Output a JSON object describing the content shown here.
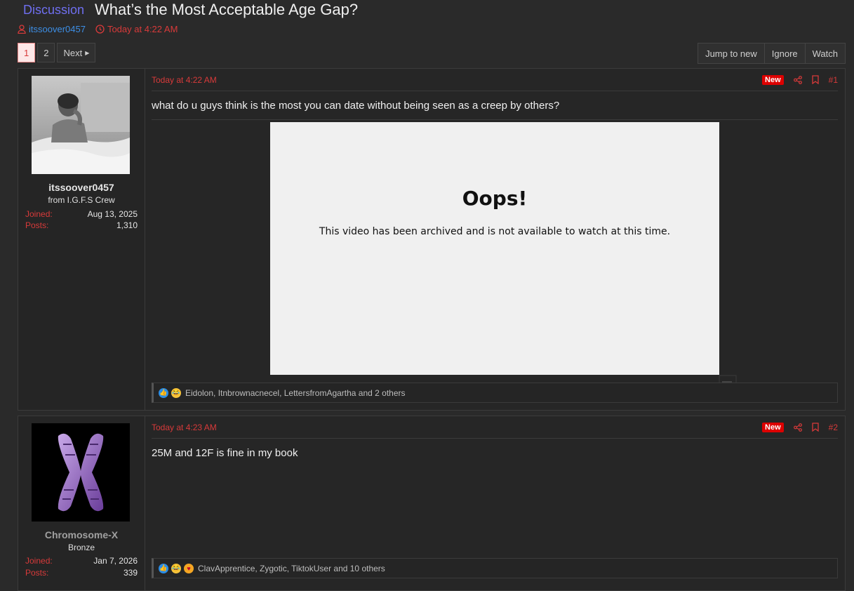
{
  "thread": {
    "prefix": "Discussion",
    "title": "What’s the Most Acceptable Age Gap?",
    "author": "itssoover0457",
    "time": "Today at 4:22 AM"
  },
  "pagination": {
    "pages": [
      "1",
      "2"
    ],
    "current": "1",
    "next_label": "Next"
  },
  "actions": {
    "jump_label": "Jump to new",
    "ignore_label": "Ignore",
    "watch_label": "Watch"
  },
  "posts": [
    {
      "user": {
        "name": "itssoover0457",
        "name_color": "#3d8fe6",
        "title": "from I.G.F.S Crew",
        "joined_label": "Joined:",
        "joined": "Aug 13, 2025",
        "posts_label": "Posts:",
        "posts": "1,310"
      },
      "time": "Today at 4:22 AM",
      "badge": "New",
      "number": "#1",
      "text": "what do u guys think is the most you can date without being seen as a creep by others?",
      "video": {
        "heading": "Oops!",
        "message": "This video has been archived and is not available to watch at this time."
      },
      "reactions": {
        "icons": [
          "like-icon",
          "laugh-icon"
        ],
        "text": "Eidolon, Itnbrownacnecel, LettersfromAgartha and 2 others"
      }
    },
    {
      "user": {
        "name": "Chromosome-X",
        "name_color": "#a0a0a0",
        "title": "Bronze",
        "joined_label": "Joined:",
        "joined": "Jan 7, 2026",
        "posts_label": "Posts:",
        "posts": "339"
      },
      "time": "Today at 4:23 AM",
      "badge": "New",
      "number": "#2",
      "text": "25M and 12F is fine in my book",
      "reactions": {
        "icons": [
          "like-icon",
          "laugh-icon",
          "heart-eyes-icon"
        ],
        "text": "ClavApprentice, Zygotic, TiktokUser and 10 others"
      }
    }
  ],
  "colors": {
    "accent": "#d83a3a",
    "prefix": "#6f6ff0",
    "link": "#3d8fe6",
    "background": "#2a2a2a"
  }
}
